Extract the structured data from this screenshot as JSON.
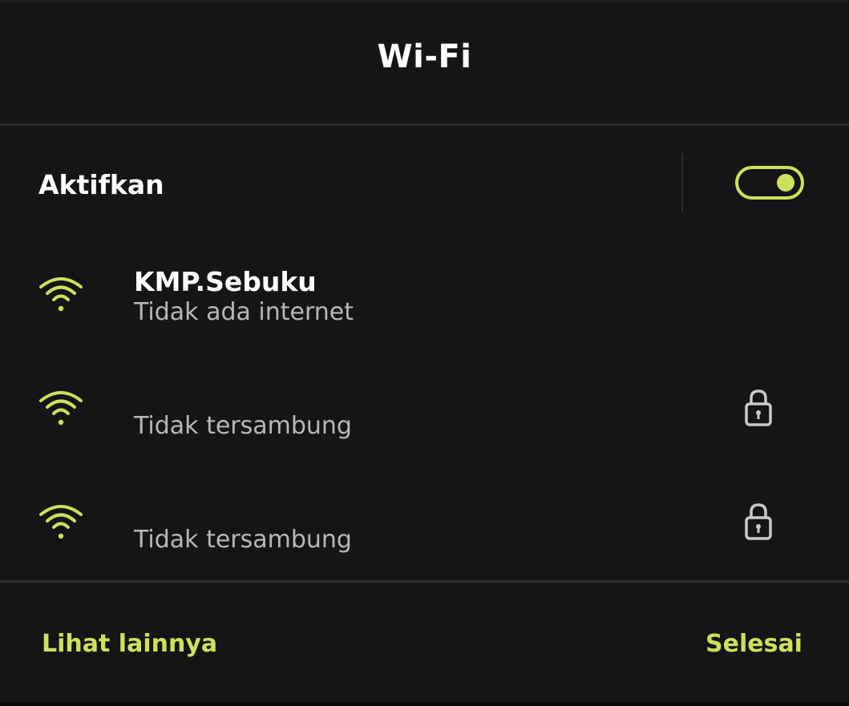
{
  "dialog": {
    "title": "Wi-Fi"
  },
  "toggle": {
    "label": "Aktifkan",
    "state": "on"
  },
  "networks": [
    {
      "name": "KMP.Sebuku",
      "status": "Tidak ada internet",
      "signal_icon": "wifi-full-icon",
      "secured": false
    },
    {
      "name": "",
      "status": "Tidak tersambung",
      "signal_icon": "wifi-full-icon",
      "secured": true,
      "lock_icon": "lock-icon"
    },
    {
      "name": "",
      "status": "Tidak tersambung",
      "signal_icon": "wifi-full-icon",
      "secured": true,
      "lock_icon": "lock-icon"
    }
  ],
  "footer": {
    "see_more_label": "Lihat lainnya",
    "done_label": "Selesai"
  },
  "colors": {
    "accent": "#cfe05a",
    "background": "#141517",
    "text_primary": "#ffffff",
    "text_secondary": "#b7b8ba"
  }
}
